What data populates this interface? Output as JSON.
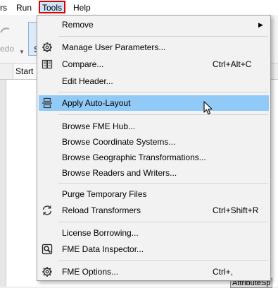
{
  "menubar": {
    "items": [
      "rs",
      "Run",
      "Tools",
      "Help"
    ]
  },
  "toolbar": {
    "redo_label": "edo",
    "button_letter": "S"
  },
  "tabs": {
    "start": "Start"
  },
  "canvas": {
    "attribute_label": "AttributeSp"
  },
  "menu": {
    "remove": "Remove",
    "manage_user_parameters": "Manage User Parameters...",
    "compare": "Compare...",
    "compare_shortcut": "Ctrl+Alt+C",
    "edit_header": "Edit Header...",
    "apply_auto_layout": "Apply Auto-Layout",
    "browse_fme_hub": "Browse FME Hub...",
    "browse_coordinate_systems": "Browse Coordinate Systems...",
    "browse_geographic_transformations": "Browse Geographic Transformations...",
    "browse_readers_writers": "Browse Readers and Writers...",
    "purge_temporary_files": "Purge Temporary Files",
    "reload_transformers": "Reload Transformers",
    "reload_transformers_shortcut": "Ctrl+Shift+R",
    "license_borrowing": "License Borrowing...",
    "fme_data_inspector": "FME Data Inspector...",
    "fme_options": "FME Options...",
    "fme_options_shortcut": "Ctrl+,"
  },
  "colors": {
    "highlight": "#91c9f7",
    "tools_outline": "#e00000"
  }
}
